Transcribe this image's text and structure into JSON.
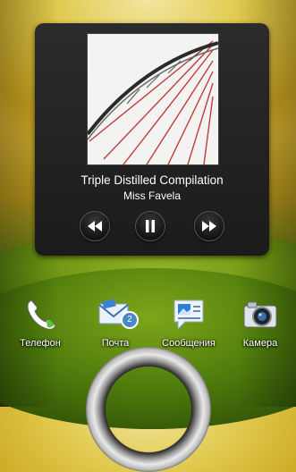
{
  "media_widget": {
    "track_title": "Triple Distilled Compilation",
    "artist": "Miss Favela"
  },
  "dock": [
    {
      "label": "Телефон",
      "icon": "phone-icon"
    },
    {
      "label": "Почта",
      "icon": "mail-icon",
      "badge": "2"
    },
    {
      "label": "Сообщения",
      "icon": "messages-icon"
    },
    {
      "label": "Камера",
      "icon": "camera-icon"
    }
  ],
  "colors": {
    "widget_background": "#222222",
    "text": "#ffffff",
    "badge": "#4a88c8"
  }
}
